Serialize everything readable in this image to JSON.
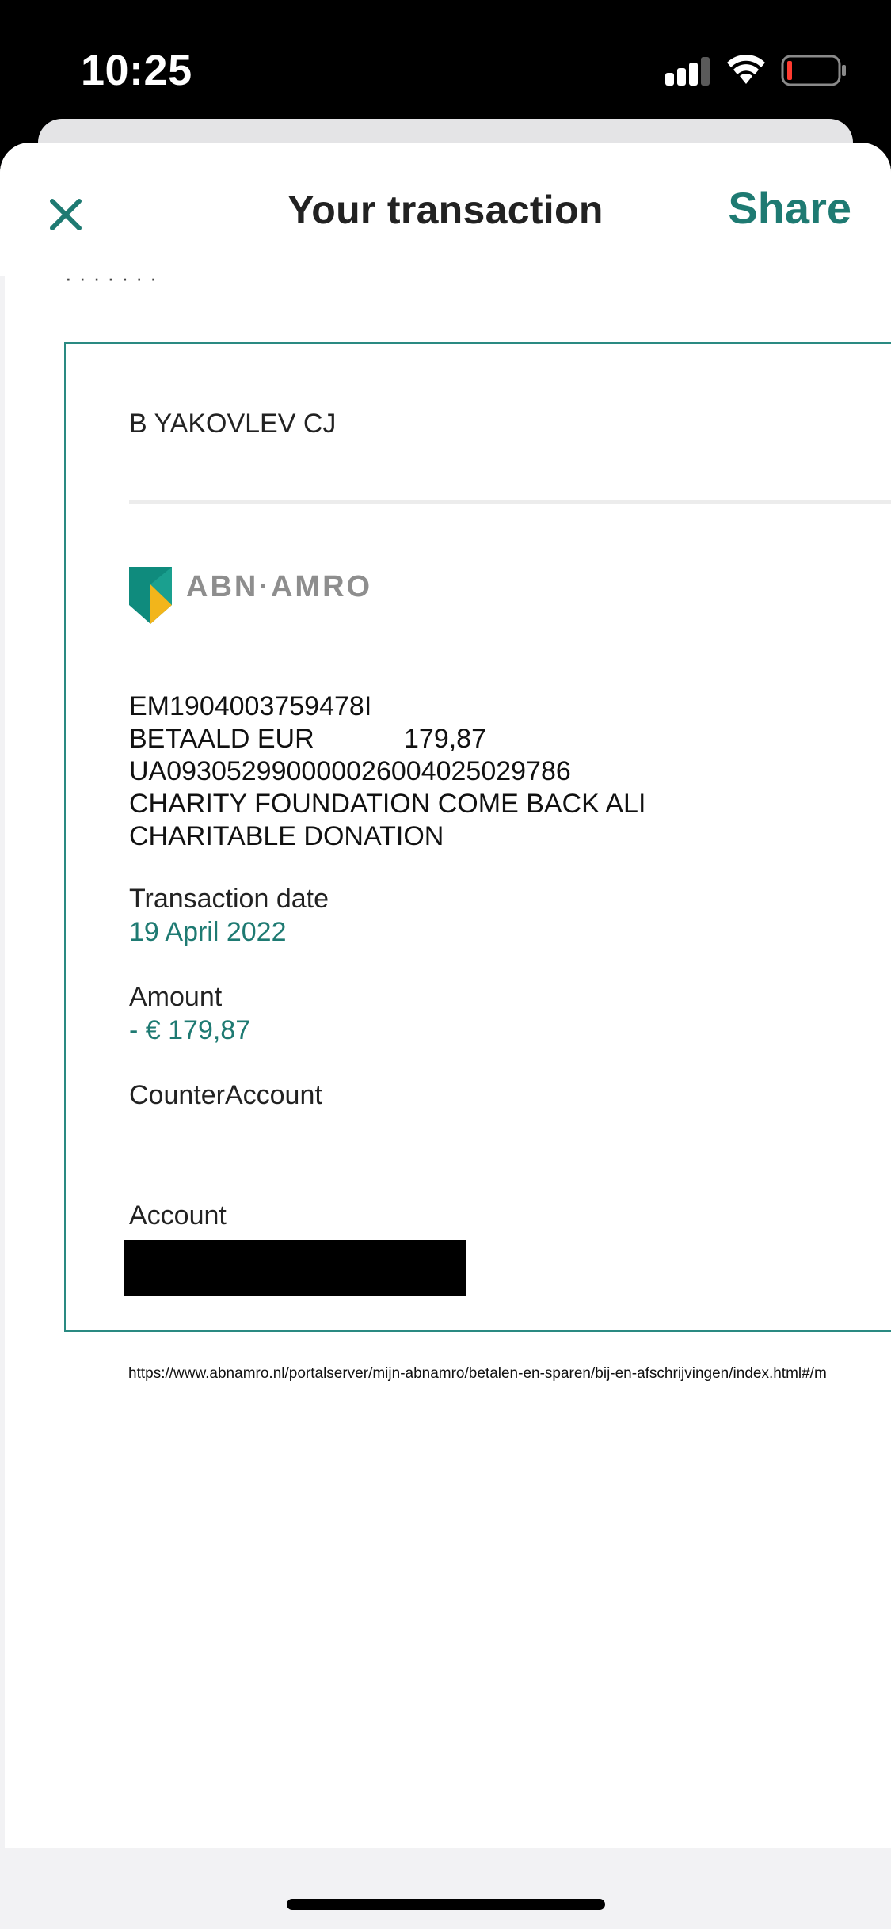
{
  "status_bar": {
    "time": "10:25"
  },
  "nav": {
    "title": "Your transaction",
    "share_label": "Share"
  },
  "document": {
    "account_holder": "B YAKOVLEV CJ",
    "bank_name": "ABN·AMRO",
    "description_lines": [
      "EM1904003759478I",
      "BETAALD EUR            179,87",
      "UA093052990000026004025029786",
      "CHARITY FOUNDATION COME BACK ALI",
      "CHARITABLE DONATION"
    ],
    "transaction_date_label": "Transaction date",
    "transaction_date_value": "19 April 2022",
    "amount_label": "Amount",
    "amount_value": "- € 179,87",
    "counter_account_label": "CounterAccount",
    "account_label": "Account",
    "url": "https://www.abnamro.nl/portalserver/mijn-abnamro/betalen-en-sparen/bij-en-afschrijvingen/index.html#/m"
  },
  "colors": {
    "accent": "#1e7a72",
    "frame": "#2a8a82",
    "logo_teal": "#0f8b7d",
    "logo_yellow": "#f2b51b"
  },
  "icons": {
    "close": "close-icon",
    "signal": "cellular-signal-icon",
    "wifi": "wifi-icon",
    "battery": "battery-low-icon"
  }
}
